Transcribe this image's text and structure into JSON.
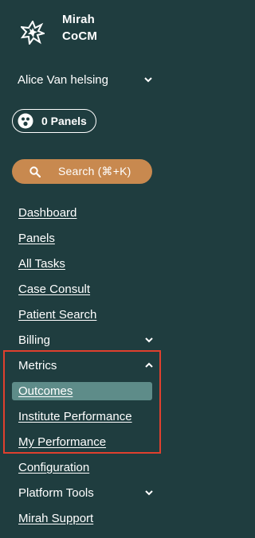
{
  "brand": {
    "line1": "Mirah",
    "line2": "CoCM",
    "logo_icon": "starburst-logo-icon"
  },
  "user": {
    "name": "Alice Van helsing",
    "chevron_icon": "chevron-down-icon"
  },
  "panels": {
    "label": "0 Panels",
    "icon": "panels-face-icon"
  },
  "search": {
    "label": "Search  (⌘+K)",
    "icon": "search-icon"
  },
  "nav": {
    "dashboard": "Dashboard",
    "panels": "Panels",
    "all_tasks": "All Tasks",
    "case_consult": "Case Consult",
    "patient_search": "Patient Search",
    "billing": "Billing",
    "metrics": "Metrics",
    "outcomes": "Outcomes",
    "institute_performance": "Institute Performance",
    "my_performance": "My Performance",
    "configuration": "Configuration",
    "platform_tools": "Platform Tools",
    "mirah_support": "Mirah Support"
  },
  "colors": {
    "background": "#1f3d3f",
    "search_bg": "#c8894f",
    "active_bg": "#5e8c89",
    "highlight_border": "#e0402e"
  }
}
